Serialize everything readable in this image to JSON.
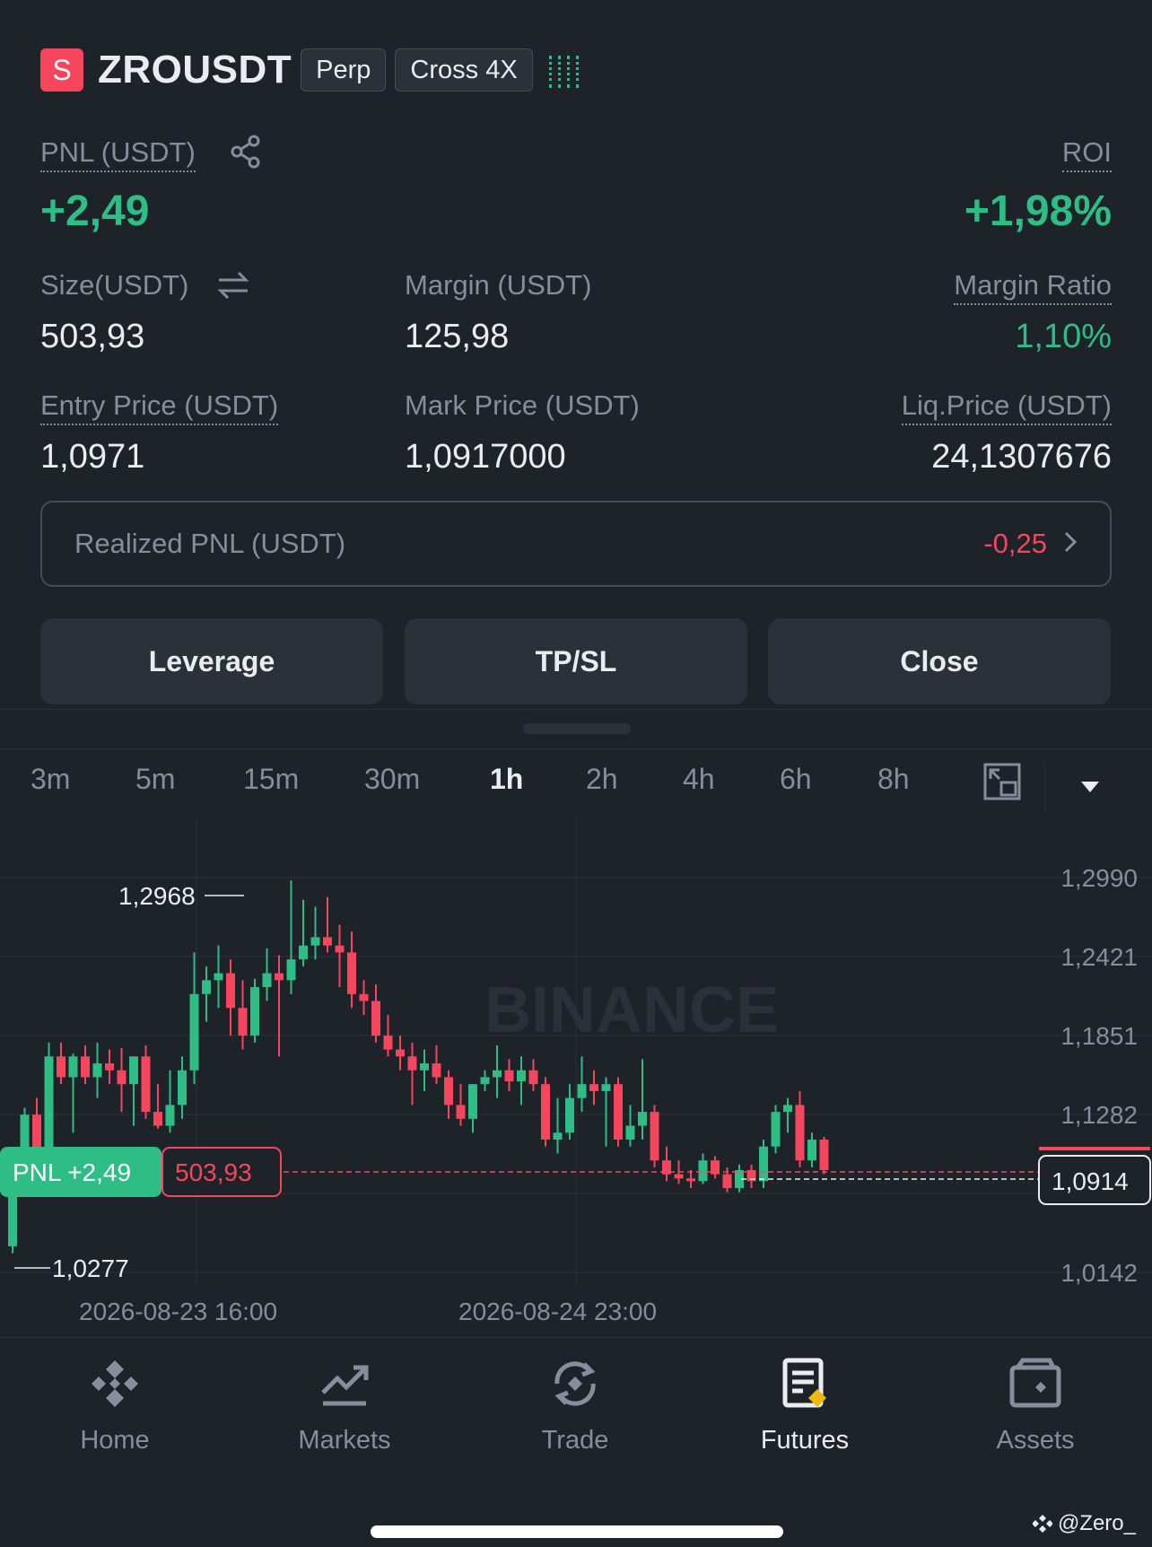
{
  "header": {
    "side_badge": "S",
    "symbol": "ZROUSDT",
    "tag_perp": "Perp",
    "tag_margin": "Cross 4X"
  },
  "pnl": {
    "label": "PNL (USDT)",
    "value": "+2,49",
    "roi_label": "ROI",
    "roi_value": "+1,98%"
  },
  "stats": {
    "size_label": "Size(USDT)",
    "size_value": "503,93",
    "margin_label": "Margin (USDT)",
    "margin_value": "125,98",
    "margin_ratio_label": "Margin Ratio",
    "margin_ratio_value": "1,10%",
    "entry_label": "Entry Price (USDT)",
    "entry_value": "1,0971",
    "mark_label": "Mark Price (USDT)",
    "mark_value": "1,0917000",
    "liq_label": "Liq.Price (USDT)",
    "liq_value": "24,1307676"
  },
  "realized": {
    "label": "Realized PNL (USDT)",
    "value": "-0,25"
  },
  "actions": {
    "leverage": "Leverage",
    "tpsl": "TP/SL",
    "close": "Close"
  },
  "timeframes": {
    "items": [
      "3m",
      "5m",
      "15m",
      "30m",
      "1h",
      "2h",
      "4h",
      "6h",
      "8h"
    ],
    "active": "1h"
  },
  "chart": {
    "watermark": "BINANCE",
    "high_label": "1,2968",
    "low_label": "1,0277",
    "pnl_tag": "PNL +2,49",
    "size_tag": "503,93",
    "current_price": "1,0914",
    "y_ticks": [
      "1,2990",
      "1,2421",
      "1,1851",
      "1,1282",
      "1,0142"
    ],
    "x_ticks": [
      "2026-08-23 16:00",
      "2026-08-24 23:00"
    ]
  },
  "chart_data": {
    "type": "candlestick",
    "interval": "1h",
    "ylim": [
      1.0142,
      1.299
    ],
    "y_ticks": [
      1.299,
      1.2421,
      1.1851,
      1.1282,
      1.0142
    ],
    "x_ticks": [
      "2026-08-23 16:00",
      "2026-08-24 23:00"
    ],
    "current_price": 1.0914,
    "entry_price": 1.0971,
    "high": 1.2968,
    "low": 1.0277,
    "candles": [
      {
        "o": 1.033,
        "h": 1.043,
        "l": 1.028,
        "c": 1.084
      },
      {
        "o": 1.084,
        "h": 1.133,
        "l": 1.08,
        "c": 1.128
      },
      {
        "o": 1.128,
        "h": 1.14,
        "l": 1.095,
        "c": 1.104
      },
      {
        "o": 1.104,
        "h": 1.18,
        "l": 1.1,
        "c": 1.17
      },
      {
        "o": 1.17,
        "h": 1.18,
        "l": 1.15,
        "c": 1.155
      },
      {
        "o": 1.155,
        "h": 1.172,
        "l": 1.115,
        "c": 1.17
      },
      {
        "o": 1.17,
        "h": 1.178,
        "l": 1.15,
        "c": 1.155
      },
      {
        "o": 1.155,
        "h": 1.18,
        "l": 1.14,
        "c": 1.165
      },
      {
        "o": 1.165,
        "h": 1.175,
        "l": 1.15,
        "c": 1.16
      },
      {
        "o": 1.16,
        "h": 1.176,
        "l": 1.13,
        "c": 1.15
      },
      {
        "o": 1.15,
        "h": 1.17,
        "l": 1.12,
        "c": 1.17
      },
      {
        "o": 1.17,
        "h": 1.178,
        "l": 1.125,
        "c": 1.13
      },
      {
        "o": 1.13,
        "h": 1.15,
        "l": 1.118,
        "c": 1.12
      },
      {
        "o": 1.12,
        "h": 1.16,
        "l": 1.115,
        "c": 1.135
      },
      {
        "o": 1.135,
        "h": 1.17,
        "l": 1.125,
        "c": 1.16
      },
      {
        "o": 1.16,
        "h": 1.245,
        "l": 1.15,
        "c": 1.215
      },
      {
        "o": 1.215,
        "h": 1.235,
        "l": 1.195,
        "c": 1.225
      },
      {
        "o": 1.225,
        "h": 1.25,
        "l": 1.205,
        "c": 1.23
      },
      {
        "o": 1.23,
        "h": 1.24,
        "l": 1.185,
        "c": 1.205
      },
      {
        "o": 1.205,
        "h": 1.225,
        "l": 1.175,
        "c": 1.185
      },
      {
        "o": 1.185,
        "h": 1.226,
        "l": 1.18,
        "c": 1.22
      },
      {
        "o": 1.22,
        "h": 1.248,
        "l": 1.21,
        "c": 1.23
      },
      {
        "o": 1.23,
        "h": 1.243,
        "l": 1.17,
        "c": 1.225
      },
      {
        "o": 1.225,
        "h": 1.297,
        "l": 1.215,
        "c": 1.24
      },
      {
        "o": 1.24,
        "h": 1.283,
        "l": 1.235,
        "c": 1.25
      },
      {
        "o": 1.25,
        "h": 1.278,
        "l": 1.24,
        "c": 1.256
      },
      {
        "o": 1.256,
        "h": 1.285,
        "l": 1.245,
        "c": 1.25
      },
      {
        "o": 1.25,
        "h": 1.265,
        "l": 1.22,
        "c": 1.245
      },
      {
        "o": 1.245,
        "h": 1.26,
        "l": 1.205,
        "c": 1.215
      },
      {
        "o": 1.215,
        "h": 1.225,
        "l": 1.2,
        "c": 1.21
      },
      {
        "o": 1.21,
        "h": 1.222,
        "l": 1.18,
        "c": 1.185
      },
      {
        "o": 1.185,
        "h": 1.2,
        "l": 1.17,
        "c": 1.175
      },
      {
        "o": 1.175,
        "h": 1.185,
        "l": 1.16,
        "c": 1.17
      },
      {
        "o": 1.17,
        "h": 1.18,
        "l": 1.135,
        "c": 1.16
      },
      {
        "o": 1.16,
        "h": 1.175,
        "l": 1.145,
        "c": 1.165
      },
      {
        "o": 1.165,
        "h": 1.178,
        "l": 1.15,
        "c": 1.155
      },
      {
        "o": 1.155,
        "h": 1.16,
        "l": 1.125,
        "c": 1.135
      },
      {
        "o": 1.135,
        "h": 1.15,
        "l": 1.12,
        "c": 1.125
      },
      {
        "o": 1.125,
        "h": 1.15,
        "l": 1.115,
        "c": 1.15
      },
      {
        "o": 1.15,
        "h": 1.16,
        "l": 1.145,
        "c": 1.155
      },
      {
        "o": 1.155,
        "h": 1.178,
        "l": 1.14,
        "c": 1.16
      },
      {
        "o": 1.16,
        "h": 1.168,
        "l": 1.145,
        "c": 1.152
      },
      {
        "o": 1.152,
        "h": 1.17,
        "l": 1.135,
        "c": 1.16
      },
      {
        "o": 1.16,
        "h": 1.168,
        "l": 1.145,
        "c": 1.15
      },
      {
        "o": 1.15,
        "h": 1.155,
        "l": 1.105,
        "c": 1.11
      },
      {
        "o": 1.11,
        "h": 1.14,
        "l": 1.1,
        "c": 1.115
      },
      {
        "o": 1.115,
        "h": 1.15,
        "l": 1.11,
        "c": 1.14
      },
      {
        "o": 1.14,
        "h": 1.17,
        "l": 1.13,
        "c": 1.15
      },
      {
        "o": 1.15,
        "h": 1.16,
        "l": 1.135,
        "c": 1.145
      },
      {
        "o": 1.145,
        "h": 1.155,
        "l": 1.105,
        "c": 1.15
      },
      {
        "o": 1.15,
        "h": 1.155,
        "l": 1.105,
        "c": 1.11
      },
      {
        "o": 1.11,
        "h": 1.135,
        "l": 1.105,
        "c": 1.12
      },
      {
        "o": 1.12,
        "h": 1.168,
        "l": 1.11,
        "c": 1.13
      },
      {
        "o": 1.13,
        "h": 1.135,
        "l": 1.09,
        "c": 1.095
      },
      {
        "o": 1.095,
        "h": 1.105,
        "l": 1.08,
        "c": 1.085
      },
      {
        "o": 1.085,
        "h": 1.095,
        "l": 1.078,
        "c": 1.082
      },
      {
        "o": 1.082,
        "h": 1.088,
        "l": 1.075,
        "c": 1.08
      },
      {
        "o": 1.08,
        "h": 1.1,
        "l": 1.078,
        "c": 1.095
      },
      {
        "o": 1.095,
        "h": 1.098,
        "l": 1.082,
        "c": 1.085
      },
      {
        "o": 1.085,
        "h": 1.09,
        "l": 1.072,
        "c": 1.075
      },
      {
        "o": 1.075,
        "h": 1.092,
        "l": 1.072,
        "c": 1.088
      },
      {
        "o": 1.088,
        "h": 1.092,
        "l": 1.075,
        "c": 1.08
      },
      {
        "o": 1.08,
        "h": 1.11,
        "l": 1.075,
        "c": 1.105
      },
      {
        "o": 1.105,
        "h": 1.135,
        "l": 1.1,
        "c": 1.13
      },
      {
        "o": 1.13,
        "h": 1.14,
        "l": 1.115,
        "c": 1.135
      },
      {
        "o": 1.135,
        "h": 1.145,
        "l": 1.09,
        "c": 1.095
      },
      {
        "o": 1.095,
        "h": 1.115,
        "l": 1.09,
        "c": 1.11
      },
      {
        "o": 1.11,
        "h": 1.112,
        "l": 1.085,
        "c": 1.088
      }
    ]
  },
  "bottom_nav": {
    "items": [
      "Home",
      "Markets",
      "Trade",
      "Futures",
      "Assets"
    ],
    "active": "Futures"
  },
  "footer": {
    "watermark": "@Zero_"
  }
}
